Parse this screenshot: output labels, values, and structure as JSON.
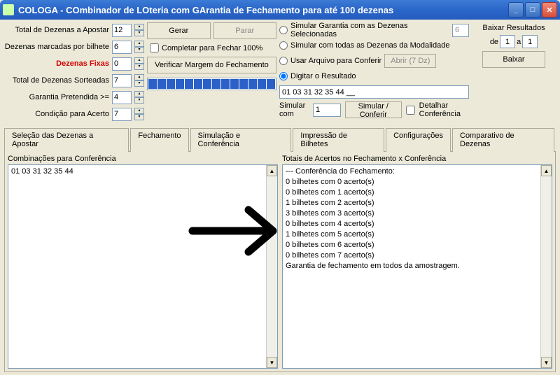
{
  "window": {
    "title": "COLOGA - COmbinador de LOteria com GArantia de Fechamento para até 100 dezenas"
  },
  "left_fields": {
    "total_apostar_label": "Total de Dezenas a Apostar",
    "total_apostar": "12",
    "marcadas_bilhete_label": "Dezenas marcadas por bilhete",
    "marcadas_bilhete": "6",
    "fixas_label": "Dezenas Fixas",
    "fixas": "0",
    "sorteadas_label": "Total de Dezenas Sorteadas",
    "sorteadas": "7",
    "garantia_label": "Garantia Pretendida >=",
    "garantia": "4",
    "condicao_label": "Condição para Acerto",
    "condicao": "7"
  },
  "mid": {
    "gerar": "Gerar",
    "parar": "Parar",
    "completar": "Completar para Fechar 100%",
    "verificar": "Verificar Margem do Fechamento"
  },
  "sim": {
    "r1": "Simular Garantia com as Dezenas Selecionadas",
    "r1_val": "6",
    "r2": "Simular com todas as Dezenas da Modalidade",
    "r3": "Usar Arquivo para Conferir",
    "abrir": "Abrir (7 Dz)",
    "r4": "Digitar o Resultado",
    "digitado": "01 03 31 32 35 44 __",
    "simular_com": "Simular com",
    "simular_com_val": "1",
    "simular_conferir": "Simular / Conferir",
    "detalhar": "Detalhar Conferência"
  },
  "download": {
    "baixar_resultados": "Baixar Resultados",
    "de": "de",
    "de_val": "1",
    "a": "a",
    "a_val": "1",
    "baixar": "Baixar"
  },
  "tabs": {
    "t1": "Seleção das Dezenas a Apostar",
    "t2": "Fechamento",
    "t3": "Simulação e Conferência",
    "t4": "Impressão de Bilhetes",
    "t5": "Configurações",
    "t6": "Comparativo de Dezenas"
  },
  "panes": {
    "left_label": "Combinações para Conferência",
    "right_label": "Totais de Acertos no Fechamento x Conferência",
    "left_content": "01 03 31 32 35 44",
    "right_lines": [
      "--- Conferência do Fechamento:",
      "0 bilhetes com 0 acerto(s)",
      "0 bilhetes com 1 acerto(s)",
      "1 bilhetes com 2 acerto(s)",
      "3 bilhetes com 3 acerto(s)",
      "0 bilhetes com 4 acerto(s)",
      "1 bilhetes com 5 acerto(s)",
      "0 bilhetes com 6 acerto(s)",
      "0 bilhetes com 7 acerto(s)",
      "Garantia de fechamento em todos da amostragem."
    ]
  }
}
